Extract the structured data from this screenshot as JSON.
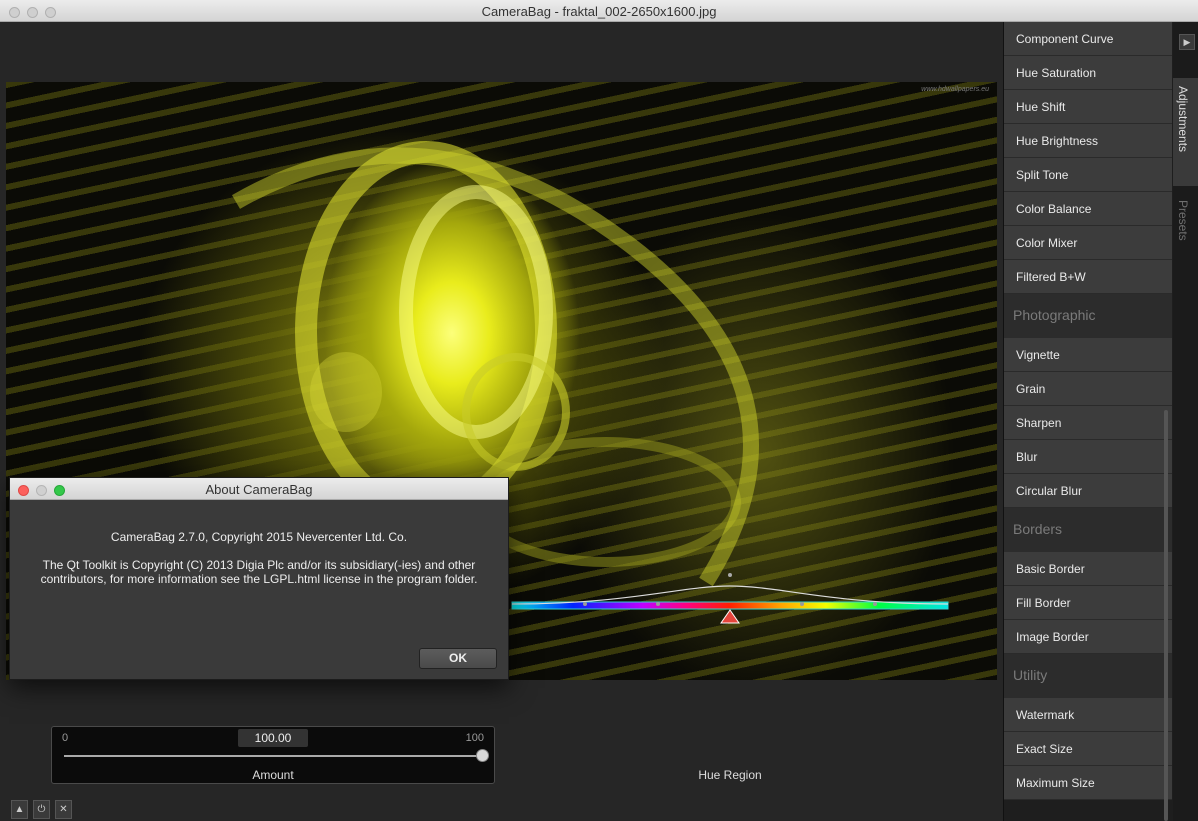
{
  "window": {
    "title": "CameraBag - fraktal_002-2650x1600.jpg"
  },
  "image": {
    "watermark": "www.hdwallpapers.eu"
  },
  "dialog": {
    "title": "About CameraBag",
    "line1": "CameraBag 2.7.0, Copyright 2015 Nevercenter Ltd. Co.",
    "line2": "The Qt Toolkit is Copyright (C) 2013 Digia Plc and/or its subsidiary(-ies) and other contributors, for more information see the LGPL.html license in the program folder.",
    "ok_label": "OK"
  },
  "amount": {
    "min_label": "0",
    "max_label": "100",
    "value": "100.00",
    "fraction": 1.0,
    "label": "Amount"
  },
  "hue_region": {
    "label": "Hue Region"
  },
  "controls": {
    "up_icon": "triangle-up-icon",
    "power_icon": "power-icon",
    "close_icon": "close-icon"
  },
  "sidebar": {
    "items_top": [
      "Component Curve",
      "Hue Saturation",
      "Hue Shift",
      "Hue Brightness",
      "Split Tone",
      "Color Balance",
      "Color Mixer",
      "Filtered B+W"
    ],
    "sections": [
      {
        "title": "Photographic",
        "items": [
          "Vignette",
          "Grain",
          "Sharpen",
          "Blur",
          "Circular Blur"
        ]
      },
      {
        "title": "Borders",
        "items": [
          "Basic Border",
          "Fill Border",
          "Image Border"
        ]
      },
      {
        "title": "Utility",
        "items": [
          "Watermark",
          "Exact Size",
          "Maximum Size"
        ]
      }
    ],
    "tabs": {
      "adjustments": "Adjustments",
      "presets": "Presets"
    }
  }
}
